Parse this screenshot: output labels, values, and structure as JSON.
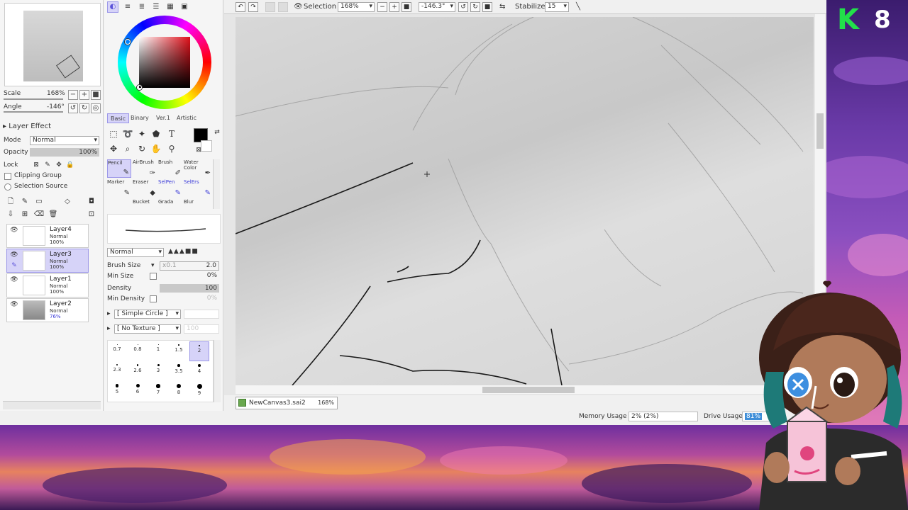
{
  "navigator": {
    "scale_label": "Scale",
    "scale_value": "168%",
    "angle_label": "Angle",
    "angle_value": "-146°"
  },
  "layer_panel": {
    "effect_label": "Layer Effect",
    "mode_label": "Mode",
    "mode_value": "Normal",
    "opacity_label": "Opacity",
    "opacity_value": "100%",
    "lock_label": "Lock",
    "clipping_label": "Clipping Group",
    "selection_source_label": "Selection Source",
    "layers": [
      {
        "name": "Layer4",
        "mode": "Normal",
        "opacity": "100%"
      },
      {
        "name": "Layer3",
        "mode": "Normal",
        "opacity": "100%"
      },
      {
        "name": "Layer1",
        "mode": "Normal",
        "opacity": "100%"
      },
      {
        "name": "Layer2",
        "mode": "Normal",
        "opacity": "76%"
      }
    ]
  },
  "tool_panel": {
    "tabs": [
      "Basic",
      "Binary",
      "Ver.1",
      "Artistic"
    ],
    "brushes": [
      "Pencil",
      "AirBrush",
      "Brush",
      "Water Color",
      "Marker",
      "Eraser",
      "SelPen",
      "SelErs",
      "Bucket",
      "Grada",
      "Blur"
    ],
    "blend_mode": "Normal",
    "brush_size_label": "Brush Size",
    "brush_size_mult": "x0.1",
    "brush_size_value": "2.0",
    "min_size_label": "Min Size",
    "min_size_value": "0%",
    "density_label": "Density",
    "density_value": "100",
    "min_density_label": "Min Density",
    "min_density_value": "0%",
    "shape_value": "[ Simple Circle ]",
    "texture_value": "[ No Texture ]",
    "texture_strength": "100",
    "sizes": [
      "0.7",
      "0.8",
      "1",
      "1.5",
      "2",
      "2.3",
      "2.6",
      "3",
      "3.5",
      "4",
      "5",
      "6",
      "7",
      "8",
      "9"
    ]
  },
  "toolbar": {
    "selection_label": "Selection",
    "zoom_value": "168%",
    "angle_value": "-146.3°",
    "stabilizer_label": "Stabilizer",
    "stabilizer_value": "15"
  },
  "status": {
    "doc_name": "NewCanvas3.sai2",
    "doc_zoom": "168%",
    "memory_label": "Memory Usage",
    "memory_value": "2% (2%)",
    "drive_label": "Drive Usage",
    "drive_value": "81%"
  },
  "overlay": {
    "counter_letter": "K",
    "counter_value": "8"
  },
  "colors": {
    "accent": "#d6d3f8",
    "accent_border": "#9c97e8",
    "counter_green": "#22e04a"
  }
}
